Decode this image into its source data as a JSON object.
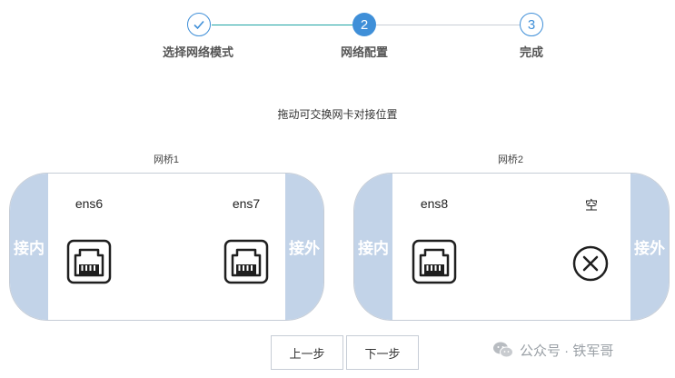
{
  "stepper": {
    "steps": [
      {
        "label": "选择网络模式",
        "number": "1",
        "state": "done"
      },
      {
        "label": "网络配置",
        "number": "2",
        "state": "active"
      },
      {
        "label": "完成",
        "number": "3",
        "state": "todo"
      }
    ],
    "accent_color": "#3f8fd8",
    "done_line_color": "#1fa4a4"
  },
  "hint": "拖动可交换网卡对接位置",
  "bridges": [
    {
      "title": "网桥1",
      "left_label": "接内",
      "right_label": "接外",
      "ports": [
        {
          "name": "ens6",
          "icon": "ethernet-port-icon"
        },
        {
          "name": "ens7",
          "icon": "ethernet-port-icon"
        }
      ]
    },
    {
      "title": "网桥2",
      "left_label": "接内",
      "right_label": "接外",
      "ports": [
        {
          "name": "ens8",
          "icon": "ethernet-port-icon"
        },
        {
          "name": "空",
          "icon": "empty-x-icon"
        }
      ]
    }
  ],
  "buttons": {
    "prev": "上一步",
    "next": "下一步"
  },
  "watermark": "公众号 · 铁军哥"
}
